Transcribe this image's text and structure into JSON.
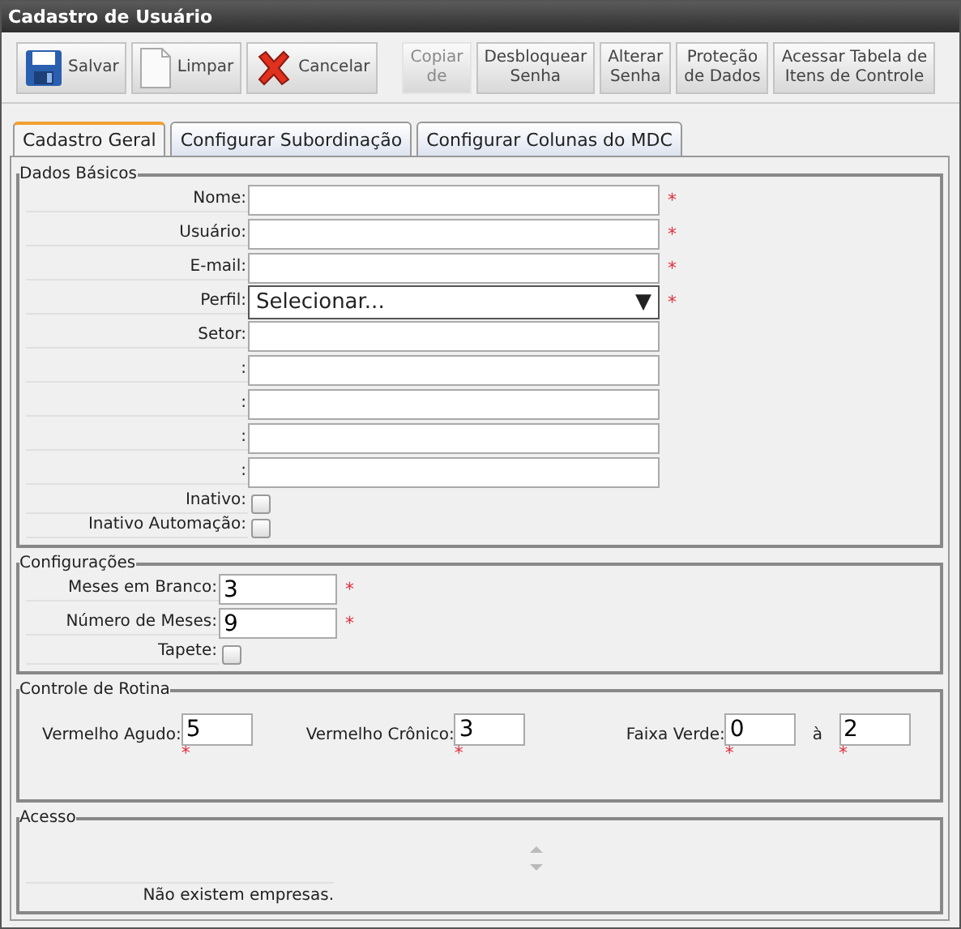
{
  "window": {
    "title": "Cadastro de Usuário"
  },
  "toolbar": [
    {
      "label": "Salvar",
      "disabled": false
    },
    {
      "label": "Limpar",
      "disabled": false
    },
    {
      "label": "Cancelar",
      "disabled": false
    },
    {
      "label": "Copiar\nde",
      "disabled": true
    },
    {
      "label": "Desbloquear\nSenha",
      "disabled": false
    },
    {
      "label": "Alterar\nSenha",
      "disabled": false
    },
    {
      "label": "Proteção\nde Dados",
      "disabled": false
    },
    {
      "label": "Acessar Tabela de\nItens de Controle",
      "disabled": false
    }
  ],
  "tabs": [
    {
      "label": "Cadastro Geral",
      "selected": true
    },
    {
      "label": "Configurar Subordinação",
      "selected": false
    },
    {
      "label": "Configurar Colunas do MDC",
      "selected": false
    }
  ],
  "dados_basicos": {
    "legend": "Dados Básicos",
    "fields": [
      {
        "label": "Nome:",
        "kind": "text",
        "required_mark": "*"
      },
      {
        "label": "Usuário:",
        "kind": "text",
        "required_mark": "*"
      },
      {
        "label": "E-mail:",
        "kind": "text",
        "required_mark": "*"
      },
      {
        "label": "Perfil:",
        "kind": "select",
        "value": "Selecionar...",
        "arrow": "▼",
        "required_mark": "*"
      },
      {
        "label": "Setor:",
        "kind": "text"
      },
      {
        "label": ":",
        "kind": "text"
      },
      {
        "label": ":",
        "kind": "text"
      },
      {
        "label": ":",
        "kind": "text"
      },
      {
        "label": ":",
        "kind": "text"
      },
      {
        "label": "Inativo:",
        "kind": "checkbox",
        "checked": false
      },
      {
        "label": "Inativo Automação:",
        "kind": "checkbox",
        "checked": false
      }
    ]
  },
  "configuracoes": {
    "legend": "Configurações",
    "fields": [
      {
        "label": "Meses em Branco:",
        "kind": "text",
        "value": "3",
        "required_mark": "*"
      },
      {
        "label": "Número de Meses:",
        "kind": "text",
        "value": "9",
        "required_mark": "*"
      },
      {
        "label": "Tapete:",
        "kind": "checkbox",
        "checked": false
      }
    ]
  },
  "controle_de_rotina": {
    "legend": "Controle de Rotina",
    "vermelho_agudo": {
      "label": "Vermelho Agudo:",
      "value": "5",
      "required_mark": "*"
    },
    "vermelho_cronico": {
      "label": "Vermelho Crônico:",
      "value": "3",
      "required_mark": "*"
    },
    "faixa_verde": {
      "label": "Faixa Verde:",
      "from": "0",
      "from_mark": "*",
      "separator": "à",
      "to": "2",
      "to_mark": "*"
    }
  },
  "acesso": {
    "legend": "Acesso",
    "empty_message": "Não existem empresas."
  }
}
